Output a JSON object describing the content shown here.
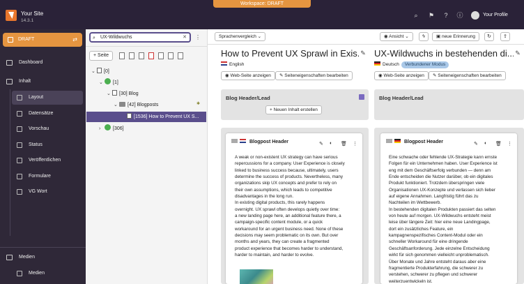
{
  "workspace_banner": "Workspace: DRAFT",
  "site": {
    "name": "Your Site",
    "version": "14.3.1"
  },
  "topbar": {
    "profile": "Your Profile",
    "icons": [
      "search-icon",
      "bookmark-icon",
      "help-icon",
      "info-icon",
      "user-icon"
    ]
  },
  "sidebar": {
    "workspace": "DRAFT",
    "items": [
      {
        "label": "Dashboard"
      },
      {
        "label": "Inhalt"
      },
      {
        "label": "Medien"
      }
    ],
    "subitems": [
      "Layout",
      "Datensätze",
      "Vorschau",
      "Status",
      "Veröffentlichen",
      "Formulare",
      "VG Wort"
    ],
    "media_sub": "Medien"
  },
  "tree": {
    "search_value": "UX-Wildwuchs",
    "new_page": "Seite",
    "nodes": [
      "[0]",
      "[1]",
      "[30] Blog",
      "[42] Blogposts",
      "[1536] How to Prevent UX S...",
      "[306]"
    ]
  },
  "toolbar": {
    "view_select": "Sprachenvergleich",
    "view": "Ansicht",
    "reminder": "neue Erinnerung"
  },
  "columns": [
    {
      "title": "How to Prevent UX Sprawl in Exis...",
      "language": "English",
      "view_btn": "Web-Seite anzeigen",
      "props_btn": "Seiteneigenschaften bearbeiten",
      "section": "Blog Header/Lead",
      "new_content": "Neuen Inhalt erstellen",
      "element_title": "Blogpost Header",
      "text": "A weak or non-existent UX strategy can have serious\nrepercussions for a company. User Experience is closely\nlinked to business success because, ultimately, users\ndetermine the success of products. Nevertheless, many\norganizations skip UX concepts and prefer to rely on\ntheir own assumptions, which leads to competitive\ndisadvantages in the long run.\nIn existing digital products, this rarely happens\novernight. UX sprawl often develops quietly over time:\na new landing page here, an additional feature there, a\ncampaign-specific content module, or a quick\nworkaround for an urgent business need. None of these\ndecisions may seem problematic on its own. But over\nmonths and years, they can create a fragmented\nproduct experience that becomes harder to understand,\nharder to maintain, and harder to evolve."
    },
    {
      "title": "UX-Wildwuchs in bestehenden di...",
      "language": "Deutsch",
      "badge": "Verbundener Modus",
      "view_btn": "Web-Seite anzeigen",
      "props_btn": "Seiteneigenschaften bearbeiten",
      "section": "Blog Header/Lead",
      "element_title": "Blogpost Header",
      "text": "Eine schwache oder fehlende UX-Strategie kann ernste\nFolgen für ein Unternehmen haben. User Experience ist\neng mit dem Geschäftserfolg verbunden — denn am\nEnde entscheiden die Nutzer darüber, ob ein digitales\nProdukt funktioniert. Trotzdem überspringen viele\nOrganisationen UX-Konzepte und verlassen sich lieber\nauf eigene Annahmen. Langfristig führt das zu\nNachteilen im Wettbewerb.\nIn bestehenden digitalen Produkten passiert das selten\nvon heute auf morgen. UX-Wildwuchs entsteht meist\nleise über längere Zeit: hier eine neue Landingpage,\ndort ein zusätzliches Feature, ein\nkampagnenspezifisches Content-Modul oder ein\nschneller Workaround für eine dringende\nGeschäftsanforderung. Jede einzelne Entscheidung\nwirkt für sich genommen vielleicht unproblematisch.\nÜber Monate und Jahre entsteht daraus aber eine\nfragmentierte Produkterfahrung, die schwerer zu\nverstehen, schwerer zu pflegen und schwerer\nweiterzuentwickeln ist."
    }
  ],
  "colors": {
    "brand": "#e8762d",
    "topbar": "#2a2238",
    "sidebar": "#2f2838",
    "draft": "#e59540",
    "selection": "#5a4e8c"
  }
}
